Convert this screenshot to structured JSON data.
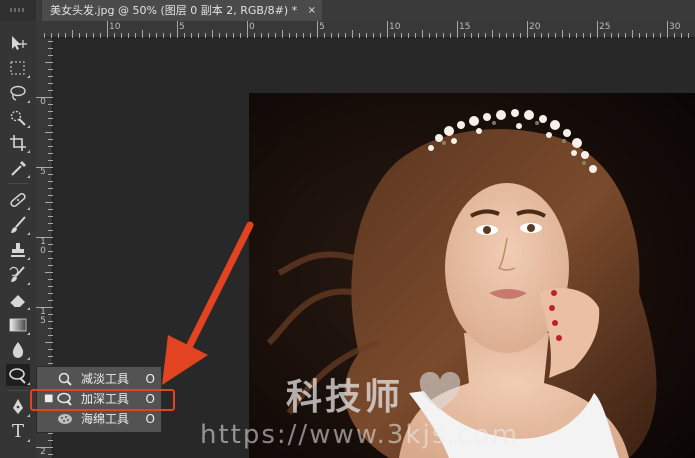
{
  "document_tab": {
    "title": "美女头发.jpg @ 50% (图层 0 副本 2, RGB/8#) *",
    "close_glyph": "×"
  },
  "ruler": {
    "top_labels": [
      "10",
      "5",
      "0",
      "5",
      "10",
      "15",
      "20",
      "25",
      "30"
    ],
    "left_labels": [
      "0",
      "5",
      "10",
      "15",
      "2"
    ]
  },
  "toolbar": {
    "tools": [
      "move-icon",
      "marquee-icon",
      "lasso-icon",
      "quick-select-icon",
      "crop-icon",
      "eyedropper-icon",
      "healing-icon",
      "brush-icon",
      "stamp-icon",
      "history-brush-icon",
      "eraser-icon",
      "gradient-icon",
      "blur-icon",
      "dodge-icon",
      "pen-icon",
      "type-icon"
    ],
    "type_glyph": "T"
  },
  "flyout": {
    "items": [
      {
        "label": "减淡工具",
        "shortcut": "O",
        "icon": "dodge-icon",
        "selected": false
      },
      {
        "label": "加深工具",
        "shortcut": "O",
        "icon": "burn-icon",
        "selected": true
      },
      {
        "label": "海绵工具",
        "shortcut": "O",
        "icon": "sponge-icon",
        "selected": false
      }
    ],
    "selected_marker": "■"
  },
  "watermark": {
    "line1": "科技师",
    "line2": "https://www.3kjs.com"
  },
  "colors": {
    "annotation": "#e24422",
    "panel": "#535353",
    "workspace": "#282828"
  }
}
